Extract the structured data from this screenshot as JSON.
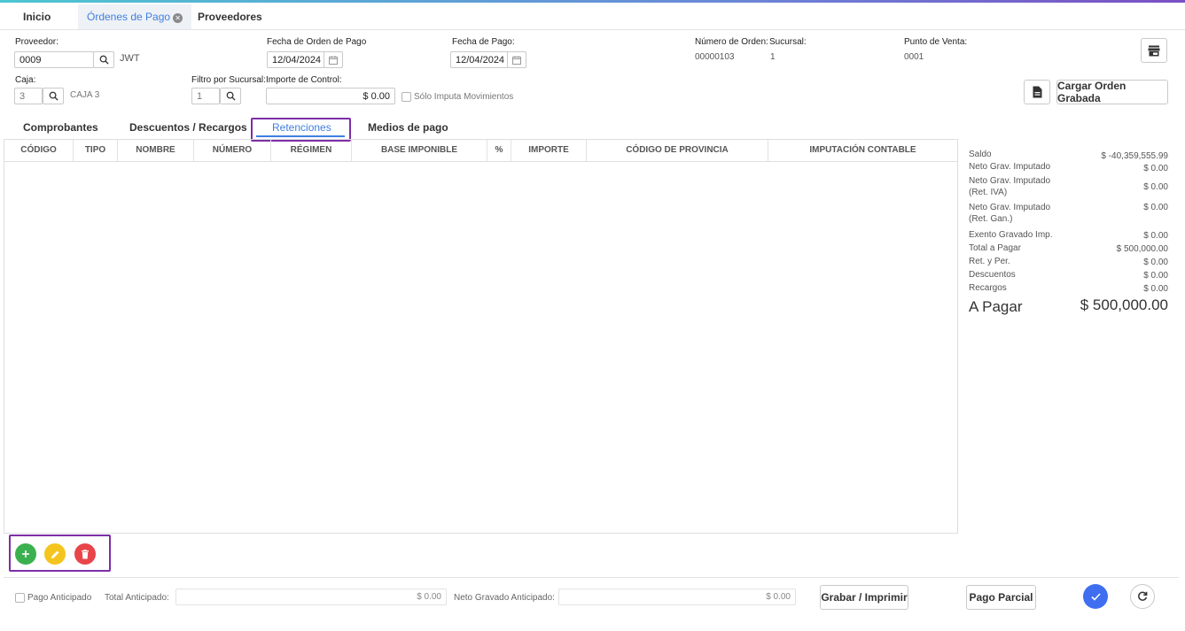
{
  "tabs": [
    {
      "label": "Inicio"
    },
    {
      "label": "Órdenes de Pago"
    },
    {
      "label": "Proveedores"
    }
  ],
  "header": {
    "proveedor_label": "Proveedor:",
    "proveedor_code": "0009",
    "proveedor_name": "JWT",
    "fecha_orden_label": "Fecha de Orden de Pago",
    "fecha_orden_value": "12/04/2024",
    "fecha_pago_label": "Fecha de Pago:",
    "fecha_pago_value": "12/04/2024",
    "numero_orden_label": "Número de Orden:",
    "numero_orden_value": "00000103",
    "sucursal_label": "Sucursal:",
    "sucursal_value": "1",
    "punto_venta_label": "Punto de Venta:",
    "punto_venta_value": "0001",
    "caja_label": "Caja:",
    "caja_code": "3",
    "caja_name": "CAJA 3",
    "filtro_sucursal_label": "Filtro por Sucursal:",
    "filtro_sucursal_value": "1",
    "importe_control_label": "Importe de Control:",
    "importe_control_value": "$ 0.00",
    "solo_imputa_label": "Sólo Imputa Movimientos",
    "cargar_orden_label": "Cargar Orden Grabada"
  },
  "content_tabs": [
    {
      "label": "Comprobantes"
    },
    {
      "label": "Descuentos / Recargos"
    },
    {
      "label": "Retenciones"
    },
    {
      "label": "Medios de pago"
    }
  ],
  "table": {
    "columns": [
      "CÓDIGO",
      "TIPO",
      "NOMBRE",
      "NÚMERO",
      "RÉGIMEN",
      "BASE IMPONIBLE",
      "%",
      "IMPORTE",
      "CÓDIGO DE PROVINCIA",
      "IMPUTACIÓN CONTABLE"
    ]
  },
  "summary": {
    "saldo_label": "Saldo",
    "saldo_value": "$ -40,359,555.99",
    "neto_grav_label": "Neto Grav. Imputado",
    "neto_grav_value": "$ 0.00",
    "neto_iva_label": "Neto Grav. Imputado (Ret. IVA)",
    "neto_iva_value": "$ 0.00",
    "neto_gan_label": "Neto Grav. Imputado (Ret. Gan.)",
    "neto_gan_value": "$ 0.00",
    "exento_label": "Exento Gravado Imp.",
    "exento_value": "$ 0.00",
    "total_pagar_label": "Total a Pagar",
    "total_pagar_value": "$ 500,000.00",
    "ret_per_label": "Ret. y Per.",
    "ret_per_value": "$ 0.00",
    "descuentos_label": "Descuentos",
    "descuentos_value": "$ 0.00",
    "recargos_label": "Recargos",
    "recargos_value": "$ 0.00",
    "a_pagar_label": "A Pagar",
    "a_pagar_value": "$ 500,000.00"
  },
  "footer": {
    "pago_anticipado_label": "Pago Anticipado",
    "total_anticipado_label": "Total Anticipado:",
    "total_anticipado_value": "$ 0.00",
    "neto_gravado_label": "Neto Gravado Anticipado:",
    "neto_gravado_value": "$ 0.00",
    "grabar_label": "Grabar / Imprimir",
    "pago_parcial_label": "Pago Parcial"
  },
  "icons": {
    "add": "plus-icon",
    "edit": "pencil-icon",
    "delete": "trash-icon",
    "confirm": "check-icon",
    "refresh": "refresh-icon",
    "store": "store-icon",
    "document": "document-icon",
    "search": "search-icon",
    "calendar": "calendar-icon"
  },
  "colors": {
    "accent": "#3f7fe0",
    "highlight": "#7d2ea8",
    "add": "#3bb04f",
    "edit": "#f4c51e",
    "delete": "#e8454a",
    "confirm": "#3f6ff0"
  }
}
